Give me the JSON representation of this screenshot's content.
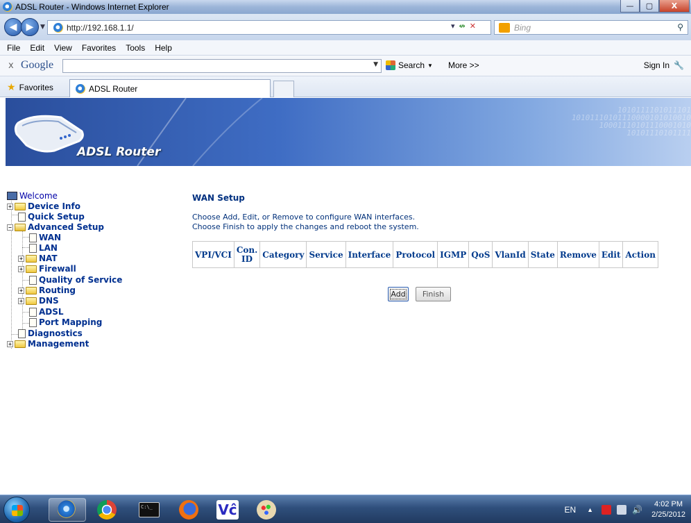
{
  "window": {
    "title": "ADSL Router - Windows Internet Explorer",
    "controls": {
      "minimize": "—",
      "maximize": "▢",
      "close": "X"
    }
  },
  "address_bar": {
    "url": "http://192.168.1.1/",
    "search_placeholder": "Bing"
  },
  "menu": [
    "File",
    "Edit",
    "View",
    "Favorites",
    "Tools",
    "Help"
  ],
  "google_toolbar": {
    "close": "x",
    "logo": "Google",
    "search_label": "Search",
    "more_label": "More >>",
    "sign_in": "Sign In"
  },
  "favorites_bar": {
    "favorites_label": "Favorites",
    "tab_title": "ADSL Router"
  },
  "banner": {
    "title": "ADSL Router",
    "binary_lines": [
      "1010111101011101",
      "10101110101110000101010010",
      "10001110101110001010",
      "10101110101111"
    ]
  },
  "tree": {
    "welcome": "Welcome",
    "device_info": "Device Info",
    "quick_setup": "Quick Setup",
    "advanced_setup": "Advanced Setup",
    "wan": "WAN",
    "lan": "LAN",
    "nat": "NAT",
    "firewall": "Firewall",
    "qos": "Quality of Service",
    "routing": "Routing",
    "dns": "DNS",
    "adsl": "ADSL",
    "port_mapping": "Port Mapping",
    "diagnostics": "Diagnostics",
    "management": "Management"
  },
  "main": {
    "title": "WAN Setup",
    "desc1": "Choose Add, Edit, or Remove to configure WAN interfaces.",
    "desc2": "Choose Finish to apply the changes and reboot the system.",
    "columns": [
      "VPI/VCI",
      "Con. ID",
      "Category",
      "Service",
      "Interface",
      "Protocol",
      "IGMP",
      "QoS",
      "VlanId",
      "State",
      "Remove",
      "Edit",
      "Action"
    ],
    "add_button": "Add",
    "finish_button": "Finish"
  },
  "taskbar": {
    "cmd_text": "C:\\_",
    "vc_text": "Vĉ",
    "lang": "EN",
    "tray_arrow": "▲",
    "time": "4:02 PM",
    "date": "2/25/2012"
  }
}
